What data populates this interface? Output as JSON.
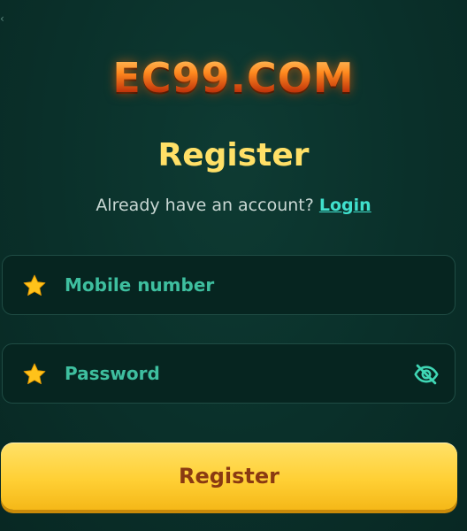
{
  "brand": {
    "logo_text": "EC99.COM",
    "logo_color": "#ff8a1f"
  },
  "header": {
    "title": "Register",
    "have_account_text": "Already have an account?",
    "login_link": "Login"
  },
  "form": {
    "mobile": {
      "placeholder": "Mobile number",
      "required_icon": "star-icon"
    },
    "password": {
      "placeholder": "Password",
      "required_icon": "star-icon",
      "toggle_icon": "eye-slash-icon"
    },
    "submit_label": "Register"
  },
  "colors": {
    "background": "#0a302a",
    "title": "#ffe067",
    "link": "#40e0cd",
    "field_text": "#3ebf9f",
    "button": "#ffd035",
    "button_text": "#8a3a12"
  }
}
